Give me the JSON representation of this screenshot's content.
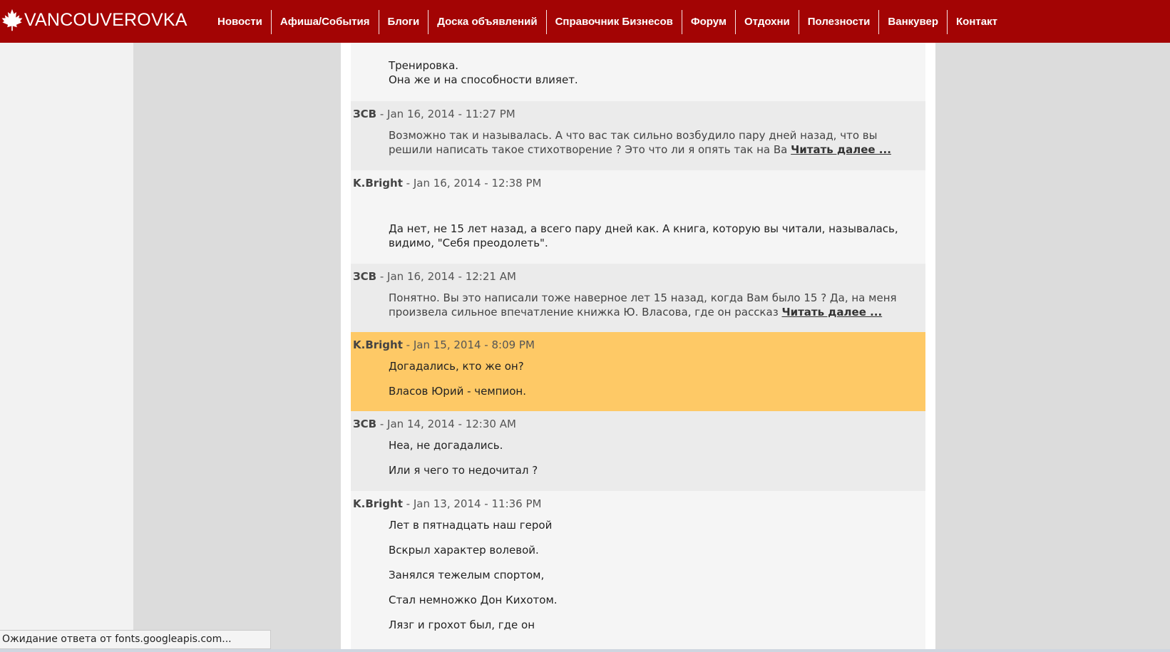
{
  "site": {
    "logo_text": "VANCOUVEROVKA",
    "brand_color": "#a30404"
  },
  "nav": [
    {
      "label": "Новости"
    },
    {
      "label": "Афиша/События"
    },
    {
      "label": "Блоги"
    },
    {
      "label": "Доска объявлений"
    },
    {
      "label": "Справочник Бизнесов"
    },
    {
      "label": "Форум"
    },
    {
      "label": "Отдохни"
    },
    {
      "label": "Полезности"
    },
    {
      "label": "Ванкувер"
    },
    {
      "label": "Контакт"
    }
  ],
  "comments": [
    {
      "author": "",
      "meta": "",
      "paragraphs": [],
      "lines": [
        "Тренировка.",
        "Она же и на способности влияет."
      ]
    },
    {
      "author": "ЗСВ",
      "meta": " - Jan 16, 2014 - 11:27 PM",
      "lines": [
        "Возможно так и называлась. А что вас так сильно возбудило пару дней назад, что вы",
        "решили написать такое стихотворение ? Это что ли я опять так на Ва"
      ],
      "read_more": "Читать далее ..."
    },
    {
      "author": "K.Bright",
      "meta": " - Jan 16, 2014 - 12:38 PM",
      "lines": [
        "Да нет, не 15 лет назад, а всего пару дней как. А книга, которую вы читали, называлась,",
        "видимо, \"Себя преодолеть\"."
      ]
    },
    {
      "author": "ЗСВ",
      "meta": " - Jan 16, 2014 - 12:21 AM",
      "lines": [
        "Понятно. Вы это написали тоже наверное лет 15 назад, когда Вам было 15 ? Да, на меня",
        "произвела сильное впечатление книжка Ю. Власова, где он рассказ"
      ],
      "read_more": "Читать далее ..."
    },
    {
      "author": "K.Bright",
      "meta": " - Jan 15, 2014 - 8:09 PM",
      "paragraphs": [
        "Догадались, кто же он?",
        "Власов Юрий - чемпион."
      ]
    },
    {
      "author": "ЗСВ",
      "meta": " - Jan 14, 2014 - 12:30 AM",
      "paragraphs": [
        "Неа, не догадались.",
        "Или я чего то недочитал ?"
      ]
    },
    {
      "author": "K.Bright",
      "meta": " - Jan 13, 2014 - 11:36 PM",
      "paragraphs": [
        "Лет в пятнадцать наш герой",
        "Вскрыл характер волевой.",
        "Занялся тежелым спортом,",
        "Стал немножко Дон Кихотом.",
        "Лязг и грохот был, где он"
      ]
    }
  ],
  "status_bar": {
    "text": "Ожидание ответа от fonts.googleapis.com..."
  }
}
